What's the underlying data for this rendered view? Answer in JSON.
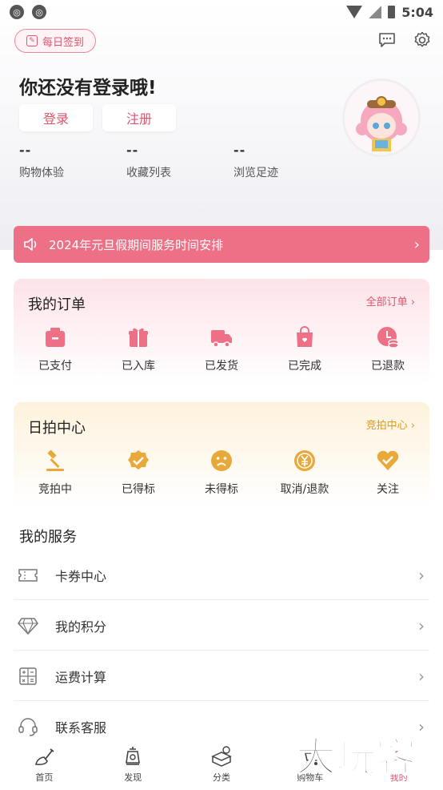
{
  "status_bar": {
    "time": "5:04"
  },
  "header": {
    "checkin_label": "每日签到",
    "greeting": "你还没有登录哦!",
    "login_label": "登录",
    "register_label": "注册",
    "stats": [
      {
        "value": "--",
        "label": "购物体验"
      },
      {
        "value": "--",
        "label": "收藏列表"
      },
      {
        "value": "--",
        "label": "浏览足迹"
      }
    ]
  },
  "notice": {
    "text": "2024年元旦假期间服务时间安排"
  },
  "orders": {
    "title": "我的订单",
    "link": "全部订单 ›",
    "items": [
      {
        "label": "已支付",
        "icon": "wallet-icon"
      },
      {
        "label": "已入库",
        "icon": "gift-box-icon"
      },
      {
        "label": "已发货",
        "icon": "truck-icon"
      },
      {
        "label": "已完成",
        "icon": "shopping-bag-icon"
      },
      {
        "label": "已退款",
        "icon": "refund-coins-icon"
      }
    ]
  },
  "auction": {
    "title": "日拍中心",
    "link": "竞拍中心 ›",
    "items": [
      {
        "label": "竞拍中",
        "icon": "gavel-icon"
      },
      {
        "label": "已得标",
        "icon": "check-badge-icon"
      },
      {
        "label": "未得标",
        "icon": "sad-face-icon"
      },
      {
        "label": "取消/退款",
        "icon": "yen-refund-icon"
      },
      {
        "label": "关注",
        "icon": "heart-check-icon"
      }
    ]
  },
  "services": {
    "title": "我的服务",
    "items": [
      {
        "label": "卡券中心",
        "icon": "ticket-icon"
      },
      {
        "label": "我的积分",
        "icon": "diamond-icon"
      },
      {
        "label": "运费计算",
        "icon": "calculator-icon"
      },
      {
        "label": "联系客服",
        "icon": "headset-icon"
      }
    ]
  },
  "tabbar": {
    "items": [
      {
        "label": "首页",
        "icon": "shovel-home-icon"
      },
      {
        "label": "发现",
        "icon": "lantern-icon"
      },
      {
        "label": "分类",
        "icon": "boxes-icon"
      },
      {
        "label": "购物车",
        "icon": "cart-icon"
      },
      {
        "label": "我的",
        "icon": "profile-icon"
      }
    ]
  },
  "watermark": {
    "text": "大玩客"
  },
  "colors": {
    "accent_pink": "#ee7086",
    "accent_gold": "#e9a93a",
    "text_pink": "#d9576e"
  }
}
